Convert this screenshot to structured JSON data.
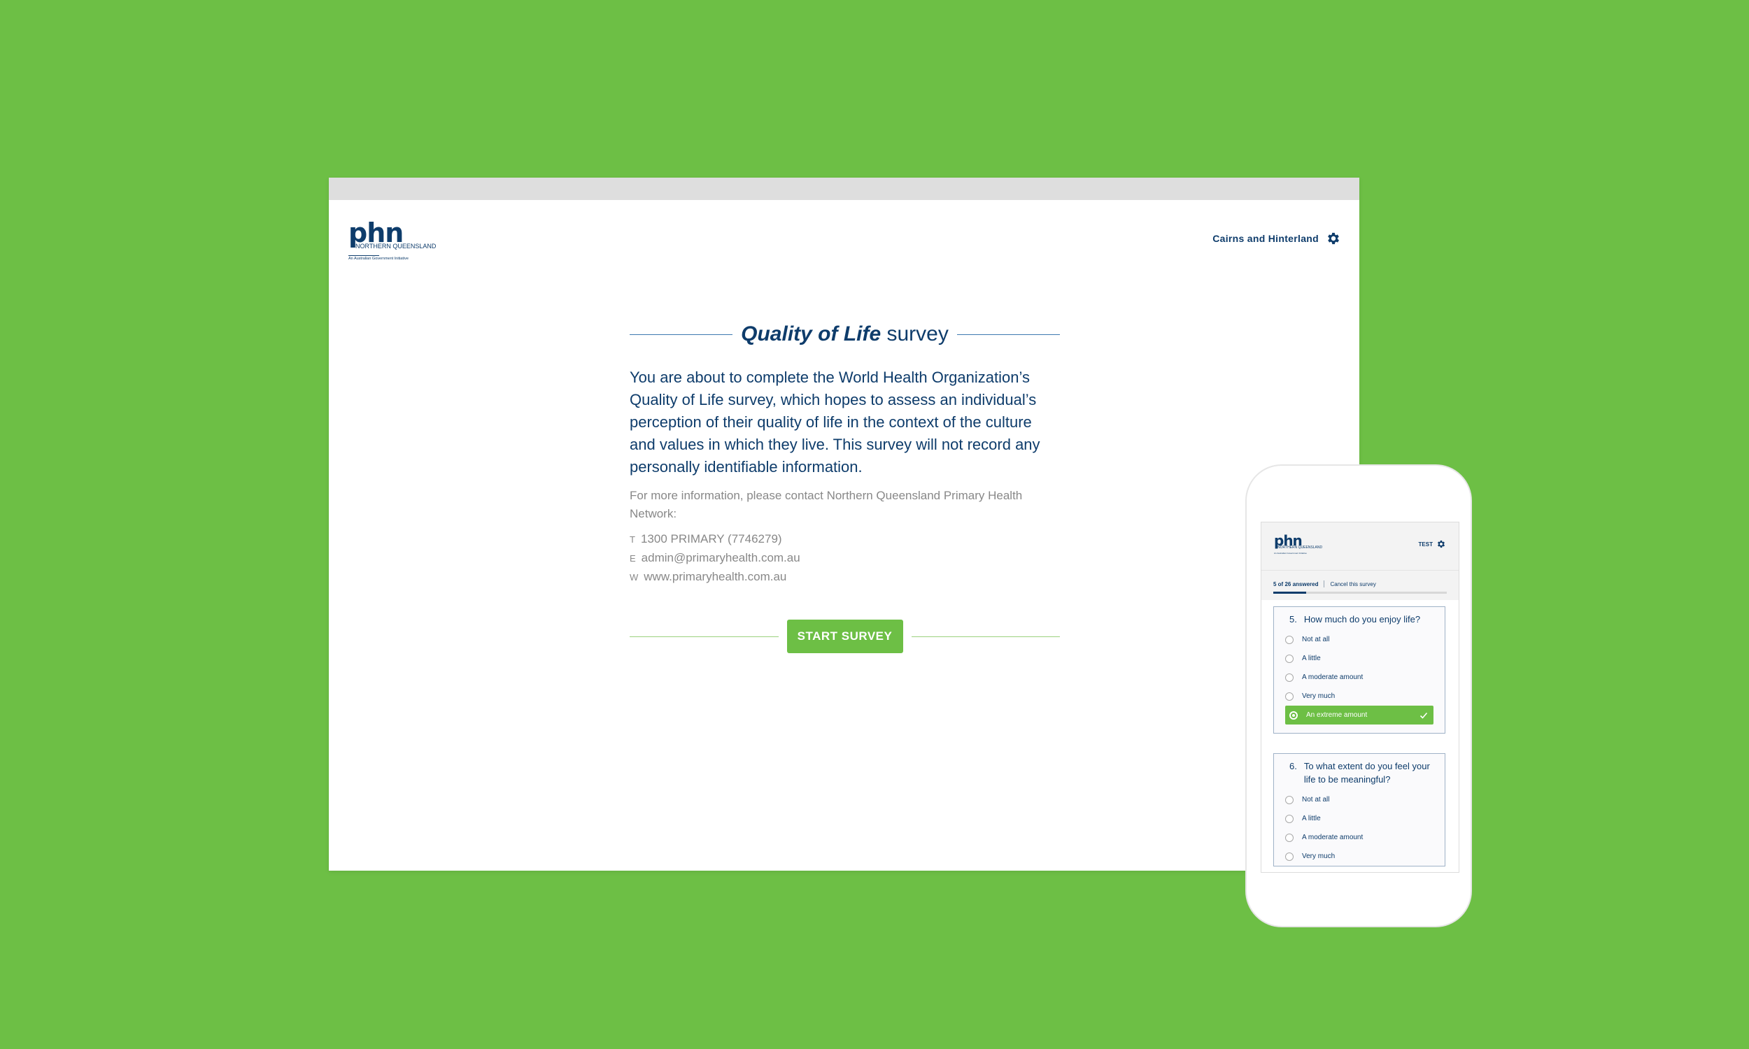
{
  "colors": {
    "background": "#6dbf45",
    "brand_navy": "#0e3c6b",
    "accent_green": "#6dbf45"
  },
  "desktop": {
    "logo": {
      "wordmark": "phn",
      "subtitle": "NORTHERN QUEENSLAND",
      "initiative": "An Australian Government Initiative"
    },
    "region": {
      "label": "Cairns and Hinterland",
      "icon": "gear-icon"
    },
    "title": {
      "emphasis": "Quality of Life",
      "rest": " survey"
    },
    "intro": "You are about to complete the World Health Organization’s Quality of Life survey, which hopes to assess an individual’s perception of their quality of life in the context of the culture and values in which they live. This survey will not record any personally identifiable information.",
    "contact_note": "For more information, please contact Northern Queensland Primary Health Network:",
    "contacts": [
      {
        "key": "T",
        "value": "1300 PRIMARY (7746279)"
      },
      {
        "key": "E",
        "value": "admin@primaryhealth.com.au"
      },
      {
        "key": "W",
        "value": "www.primaryhealth.com.au"
      }
    ],
    "start_button": "START SURVEY"
  },
  "phone": {
    "region_label": "TEST",
    "progress": {
      "answered_label": "5 of 26 answered",
      "cancel_label": "Cancel this survey",
      "fraction": 0.19
    },
    "questions": [
      {
        "number": "5.",
        "text": "How much do you enjoy life?",
        "options": [
          "Not at all",
          "A little",
          "A moderate amount",
          "Very much",
          "An extreme amount"
        ],
        "selected": "An extreme amount"
      },
      {
        "number": "6.",
        "text": "To what extent do you feel your life to be meaningful?",
        "options": [
          "Not at all",
          "A little",
          "A moderate amount",
          "Very much"
        ],
        "selected": ""
      }
    ]
  }
}
